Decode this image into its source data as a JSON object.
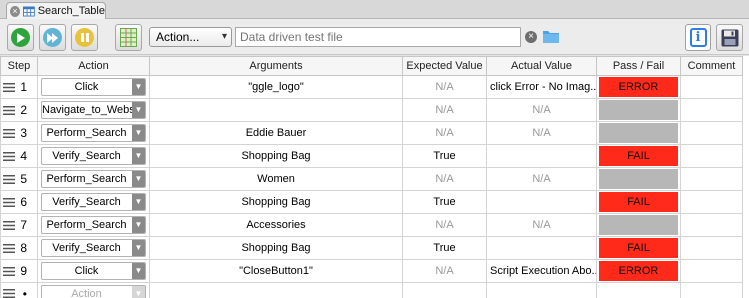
{
  "tab": {
    "title": "Search_Table",
    "close_glyph": "×"
  },
  "toolbar": {
    "action_label": "Action...",
    "action_caret": "▾",
    "file_placeholder": "Data driven test file",
    "clear_glyph": "×",
    "info_glyph": "i"
  },
  "colors": {
    "fail": "#ff2a1a",
    "empty": "#b7b7b7",
    "accent": "#2f7de2"
  },
  "icons": [
    "close-icon",
    "table-icon",
    "play-icon",
    "step-play-icon",
    "pause-icon",
    "grid-icon",
    "folder-icon",
    "info-icon",
    "save-icon",
    "drag-handle-icon",
    "chevron-down-icon"
  ],
  "columns": [
    "Step",
    "Action",
    "Arguments",
    "Expected Value",
    "Actual Value",
    "Pass / Fail",
    "Comment"
  ],
  "rows": [
    {
      "step": "1",
      "action": "Click",
      "arguments": "\"ggle_logo\"",
      "expected": "N/A",
      "actual": "click Error - No Imag...",
      "pass_fail": "ERROR",
      "status": "fail"
    },
    {
      "step": "2",
      "action": "Navigate_to_Websit",
      "arguments": "",
      "expected": "N/A",
      "actual": "N/A",
      "pass_fail": "",
      "status": "empty"
    },
    {
      "step": "3",
      "action": "Perform_Search",
      "arguments": "Eddie Bauer",
      "expected": "N/A",
      "actual": "N/A",
      "pass_fail": "",
      "status": "empty"
    },
    {
      "step": "4",
      "action": "Verify_Search",
      "arguments": "Shopping Bag",
      "expected": "True",
      "actual": "",
      "pass_fail": "FAIL",
      "status": "fail"
    },
    {
      "step": "5",
      "action": "Perform_Search",
      "arguments": "Women",
      "expected": "N/A",
      "actual": "N/A",
      "pass_fail": "",
      "status": "empty"
    },
    {
      "step": "6",
      "action": "Verify_Search",
      "arguments": "Shopping Bag",
      "expected": "True",
      "actual": "",
      "pass_fail": "FAIL",
      "status": "fail"
    },
    {
      "step": "7",
      "action": "Perform_Search",
      "arguments": "Accessories",
      "expected": "N/A",
      "actual": "N/A",
      "pass_fail": "",
      "status": "empty"
    },
    {
      "step": "8",
      "action": "Verify_Search",
      "arguments": "Shopping Bag",
      "expected": "True",
      "actual": "",
      "pass_fail": "FAIL",
      "status": "fail"
    },
    {
      "step": "9",
      "action": "Click",
      "arguments": "\"CloseButton1\"",
      "expected": "N/A",
      "actual": "Script Execution Abo...",
      "pass_fail": "ERROR",
      "status": "fail"
    }
  ],
  "new_row": {
    "step": "•",
    "action_placeholder": "Action"
  }
}
